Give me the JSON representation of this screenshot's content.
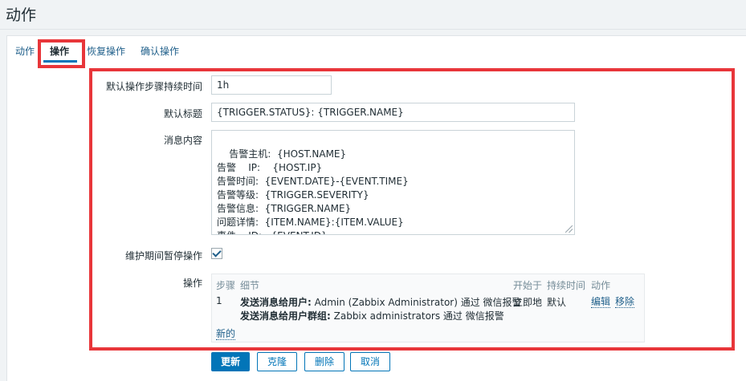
{
  "page": {
    "title": "动作"
  },
  "tabs": [
    {
      "label": "动作",
      "active": false
    },
    {
      "label": "操作",
      "active": true
    },
    {
      "label": "恢复操作",
      "active": false
    },
    {
      "label": "确认操作",
      "active": false
    }
  ],
  "form": {
    "step_duration": {
      "label": "默认操作步骤持续时间",
      "value": "1h"
    },
    "subject": {
      "label": "默认标题",
      "value": "{TRIGGER.STATUS}: {TRIGGER.NAME}"
    },
    "message": {
      "label": "消息内容",
      "value": "告警主机:  {HOST.NAME}\n告警    IP:    {HOST.IP}\n告警时间:  {EVENT.DATE}-{EVENT.TIME}\n告警等级:  {TRIGGER.SEVERITY}\n告警信息:  {TRIGGER.NAME}\n问题详情:  {ITEM.NAME}:{ITEM.VALUE}\n事件    ID:   {EVENT.ID}"
    },
    "pause": {
      "label": "维护期间暂停操作",
      "checked": true
    },
    "operations": {
      "label": "操作",
      "headers": {
        "step": "步骤",
        "details": "细节",
        "start": "开始于",
        "duration": "持续时间",
        "action": "动作"
      },
      "rows": [
        {
          "step": "1",
          "detail1_bold": "发送消息给用户:",
          "detail1_text": " Admin (Zabbix Administrator) 通过 微信报警",
          "detail2_bold": "发送消息给用户群组:",
          "detail2_text": " Zabbix administrators 通过 微信报警",
          "start": "立即地",
          "duration": "默认",
          "edit": "编辑",
          "remove": "移除"
        }
      ],
      "new_link": "新的"
    }
  },
  "buttons": {
    "update": "更新",
    "clone": "克隆",
    "delete": "删除",
    "cancel": "取消"
  },
  "colors": {
    "accent": "#0275b8",
    "highlight": "#e8363a",
    "link": "#1f5f8a"
  }
}
